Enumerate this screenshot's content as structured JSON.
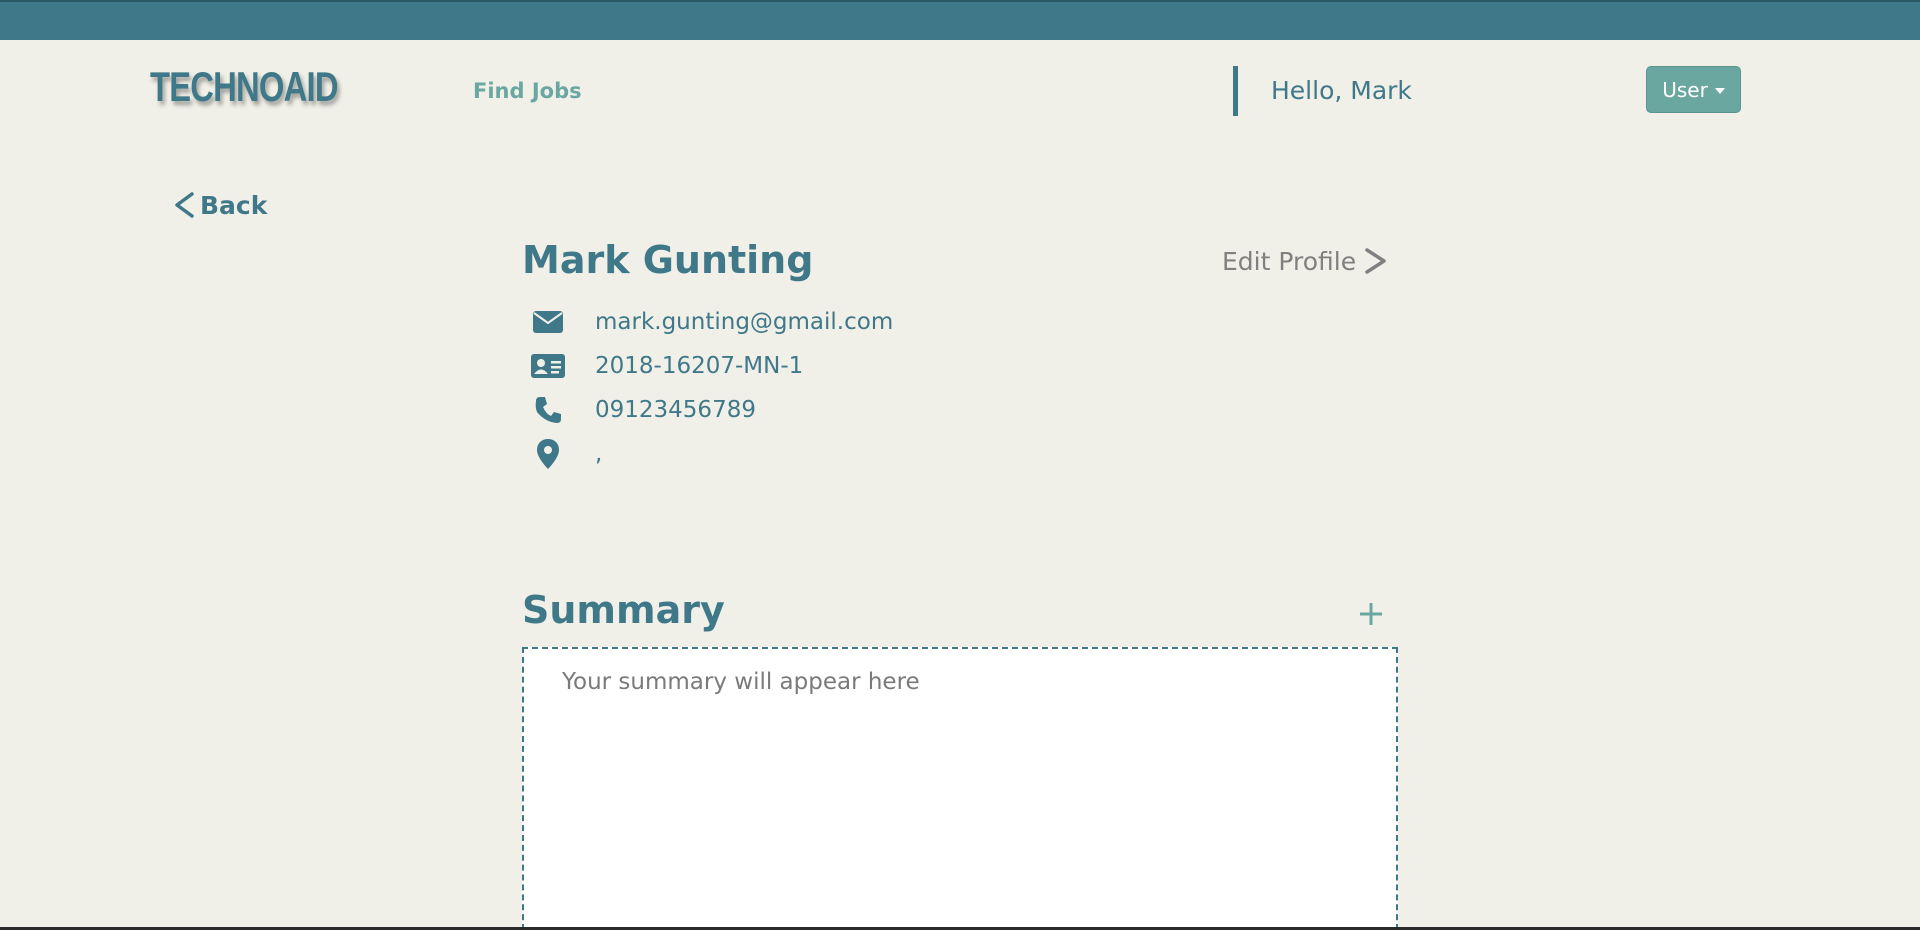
{
  "header": {
    "logo": "TECHNOAID",
    "nav_find_jobs": "Find Jobs",
    "greeting": "Hello, Mark",
    "user_menu_label": "User"
  },
  "colors": {
    "primary": "#3f7889",
    "accent": "#6aa7a0",
    "background": "#f1f0e8",
    "muted": "#808080"
  },
  "profile": {
    "back_label": "Back",
    "name": "Mark Gunting",
    "edit_label": "Edit Profile",
    "email": "mark.gunting@gmail.com",
    "student_id": "2018-16207-MN-1",
    "phone": "09123456789",
    "location": ",",
    "icons": [
      "envelope-icon",
      "id-card-icon",
      "phone-icon",
      "location-pin-icon"
    ]
  },
  "summary": {
    "title": "Summary",
    "placeholder": "Your summary will appear here"
  }
}
